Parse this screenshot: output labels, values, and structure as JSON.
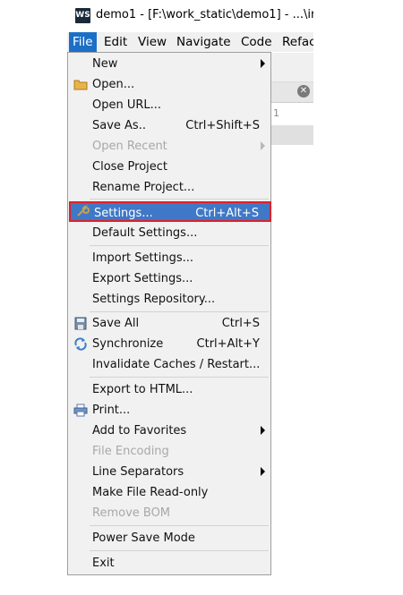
{
  "window": {
    "app_icon": "WS",
    "title": "demo1 - [F:\\work_static\\demo1] - ...\\ir"
  },
  "menubar": {
    "items": [
      "File",
      "Edit",
      "View",
      "Navigate",
      "Code",
      "Refac"
    ]
  },
  "file_menu": {
    "items": [
      {
        "label": "New",
        "shortcut": "",
        "submenu": true,
        "icon": "none"
      },
      {
        "label": "Open...",
        "shortcut": "",
        "icon": "folder-icon"
      },
      {
        "label": "Open URL...",
        "shortcut": ""
      },
      {
        "label": "Save As..",
        "shortcut": "Ctrl+Shift+S"
      },
      {
        "label": "Open Recent",
        "shortcut": "",
        "submenu": true,
        "disabled": true
      },
      {
        "label": "Close Project",
        "shortcut": ""
      },
      {
        "label": "Rename Project...",
        "shortcut": ""
      },
      {
        "label": "Settings...",
        "shortcut": "Ctrl+Alt+S",
        "highlighted": true,
        "icon": "wrench-icon"
      },
      {
        "label": "Default Settings...",
        "shortcut": ""
      },
      {
        "label": "Import Settings...",
        "shortcut": ""
      },
      {
        "label": "Export Settings...",
        "shortcut": ""
      },
      {
        "label": "Settings Repository...",
        "shortcut": ""
      },
      {
        "label": "Save All",
        "shortcut": "Ctrl+S",
        "icon": "save-icon"
      },
      {
        "label": "Synchronize",
        "shortcut": "Ctrl+Alt+Y",
        "icon": "sync-icon"
      },
      {
        "label": "Invalidate Caches / Restart...",
        "shortcut": ""
      },
      {
        "label": "Export to HTML...",
        "shortcut": ""
      },
      {
        "label": "Print...",
        "shortcut": "",
        "icon": "printer-icon"
      },
      {
        "label": "Add to Favorites",
        "shortcut": "",
        "submenu": true
      },
      {
        "label": "File Encoding",
        "shortcut": "",
        "disabled": true
      },
      {
        "label": "Line Separators",
        "shortcut": "",
        "submenu": true
      },
      {
        "label": "Make File Read-only",
        "shortcut": ""
      },
      {
        "label": "Remove BOM",
        "shortcut": "",
        "disabled": true
      },
      {
        "label": "Power Save Mode",
        "shortcut": ""
      },
      {
        "label": "Exit",
        "shortcut": ""
      }
    ]
  },
  "background": {
    "line_number": "1"
  },
  "colors": {
    "menubar_active": "#1c6fc6",
    "highlight": "#3f78c6",
    "highlight_border": "#e0202a",
    "menu_bg": "#f1f1f1"
  }
}
